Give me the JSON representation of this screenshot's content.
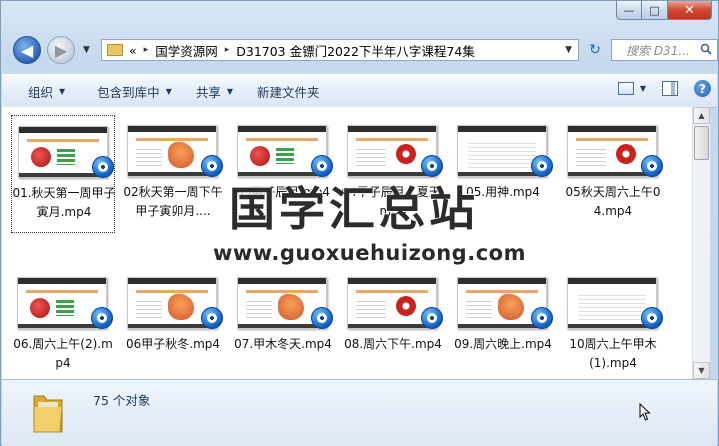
{
  "window": {
    "caption": {
      "minimize": "—",
      "maximize": "□",
      "close": "✕"
    }
  },
  "nav": {
    "back_glyph": "◀",
    "forward_glyph": "▶",
    "history_glyph": "▼",
    "breadcrumb_prefix": "«",
    "breadcrumbs": [
      "国学资源网",
      "D31703 金镖门2022下半年八字课程74集"
    ],
    "separator": "▸",
    "dropdown_glyph": "▼",
    "refresh_glyph": "↻",
    "search_placeholder": "搜索 D31..."
  },
  "toolbar": {
    "organize": "组织",
    "include_library": "包含到库中",
    "share": "共享",
    "new_folder": "新建文件夹",
    "dropdown_glyph": "▼",
    "help_glyph": "?"
  },
  "files": [
    {
      "label": "01.秋天第一周甲子寅月.mp4",
      "thumb": "red"
    },
    {
      "label": "02秋天第一周下午甲子寅卯月....",
      "thumb": "koi"
    },
    {
      "label": "03甲子辰月.mp4",
      "thumb": "red"
    },
    {
      "label": "04甲子辰月、夏天.mp4",
      "thumb": "circle"
    },
    {
      "label": "05.用神.mp4",
      "thumb": "doc"
    },
    {
      "label": "05秋天周六上午04.mp4",
      "thumb": "circle"
    },
    {
      "label": "06.周六上午(2).mp4",
      "thumb": "red"
    },
    {
      "label": "06甲子秋冬.mp4",
      "thumb": "koi"
    },
    {
      "label": "07.甲木冬天.mp4",
      "thumb": "koi"
    },
    {
      "label": "08.周六下午.mp4",
      "thumb": "circle"
    },
    {
      "label": "09.周六晚上.mp4",
      "thumb": "koi"
    },
    {
      "label": "10周六上午甲木(1).mp4",
      "thumb": "doc"
    }
  ],
  "watermark": {
    "title": "国学汇总站",
    "url": "www.guoxuehuizong.com"
  },
  "status": {
    "count": "75 个对象"
  },
  "colors": {
    "accent": "#2a63b8",
    "window_bg": "#c6d9ee",
    "close_red": "#d1472f"
  }
}
